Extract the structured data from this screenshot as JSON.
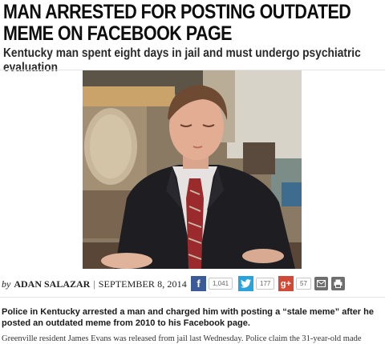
{
  "article": {
    "headline": "MAN ARRESTED FOR POSTING OUTDATED MEME ON FACEBOOK PAGE",
    "subhead": "Kentucky man spent eight days in jail and must undergo psychiatric evaluation",
    "byline": {
      "by": "by",
      "author": "ADAN SALAZAR",
      "separator": "|",
      "date": "SEPTEMBER 8, 2014"
    },
    "lede": "Police in Kentucky arrested a man and charged him with posting a “stale meme” after he posted an outdated meme from 2010 to his Facebook page.",
    "body_first_line": "Greenville resident James Evans was released from jail last Wednesday. Police claim the 31-year-old made"
  },
  "share": {
    "facebook": {
      "icon": "facebook-icon",
      "glyph": "f",
      "count": "1,041",
      "color": "#3b5b98"
    },
    "twitter": {
      "icon": "twitter-icon",
      "count": "177",
      "color": "#2aa3dc"
    },
    "googleplus": {
      "icon": "google-plus-icon",
      "glyph": "g+",
      "count": "57",
      "color": "#d14a38"
    },
    "email": {
      "icon": "email-icon"
    },
    "print": {
      "icon": "print-icon"
    }
  }
}
